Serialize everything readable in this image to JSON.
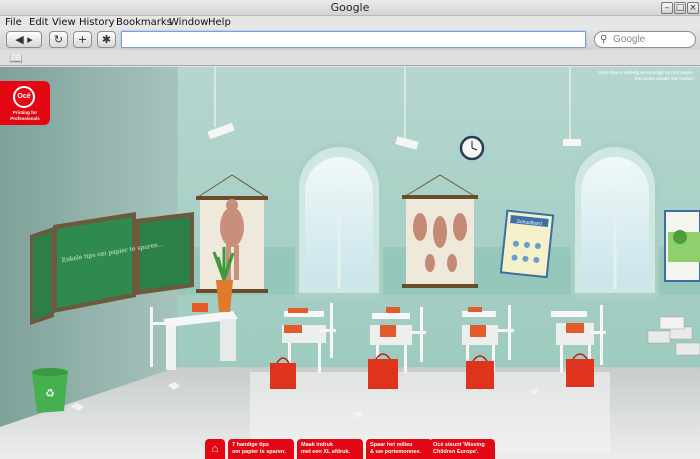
{
  "window": {
    "title": "Google"
  },
  "menu": [
    "File",
    "Edit",
    "View",
    "History",
    "Bookmarks",
    "Window",
    "Help"
  ],
  "toolbar": {
    "back_forward": "◀ ▸",
    "reload": "↻",
    "add": "+",
    "bug": "✱",
    "address_value": "",
    "search_placeholder": "Google"
  },
  "page": {
    "brand": {
      "logo": "Océ",
      "tagline": "Printing for Professionals"
    },
    "notice": {
      "line1": "Deze klas is volledig vervaardigd uit Océ papier.",
      "line2": "Een echte creatie van hoekie!"
    },
    "chalkboard_text": "Enkele tips om papier te sparen...",
    "poster_text": "Schoolbord",
    "tips": [
      {
        "label_1": "7 handige tips",
        "label_2": "om papier te sparen."
      },
      {
        "label_1": "Maak indruk",
        "label_2": "met een XL afdruk."
      },
      {
        "label_1": "Spaar het milieu",
        "label_2": "& uw portemonnee."
      },
      {
        "label_1": "Océ steunt 'Missing",
        "label_2": "Children Europe'."
      }
    ]
  },
  "colors": {
    "brand_red": "#e30613",
    "wall": "#a9cfc6",
    "floor": "#d9dcda",
    "chalkboard": "#2f8a4f"
  }
}
